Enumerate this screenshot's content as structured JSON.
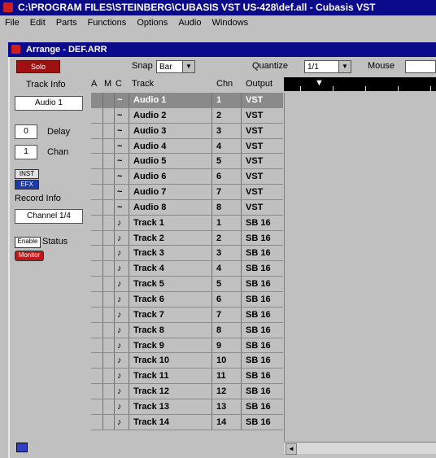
{
  "app_title": "C:\\PROGRAM FILES\\STEINBERG\\CUBASIS VST US-428\\def.all - Cubasis VST",
  "menu": [
    "File",
    "Edit",
    "Parts",
    "Functions",
    "Options",
    "Audio",
    "Windows"
  ],
  "arrange": {
    "title": "Arrange - DEF.ARR",
    "solo_label": "Solo",
    "snap_label": "Snap",
    "snap_value": "Bar",
    "quantize_label": "Quantize",
    "quantize_value": "1/1",
    "mouse_label": "Mouse"
  },
  "inspector": {
    "track_info_label": "Track Info",
    "track_name": "Audio 1",
    "delay_value": "0",
    "delay_label": "Delay",
    "chan_value": "1",
    "chan_label": "Chan",
    "inst_btn": "INST",
    "efx_btn": "EFX",
    "record_info_label": "Record Info",
    "record_channel": "Channel 1/4",
    "enable_btn": "Enable",
    "status_label": "Status",
    "monitor_btn": "Monitor"
  },
  "columns": {
    "a": "A",
    "m": "M",
    "c": "C",
    "track": "Track",
    "chn": "Chn",
    "output": "Output"
  },
  "tracks": [
    {
      "type": "~",
      "name": "Audio 1",
      "chn": "1",
      "out": "VST"
    },
    {
      "type": "~",
      "name": "Audio 2",
      "chn": "2",
      "out": "VST"
    },
    {
      "type": "~",
      "name": "Audio 3",
      "chn": "3",
      "out": "VST"
    },
    {
      "type": "~",
      "name": "Audio 4",
      "chn": "4",
      "out": "VST"
    },
    {
      "type": "~",
      "name": "Audio 5",
      "chn": "5",
      "out": "VST"
    },
    {
      "type": "~",
      "name": "Audio 6",
      "chn": "6",
      "out": "VST"
    },
    {
      "type": "~",
      "name": "Audio 7",
      "chn": "7",
      "out": "VST"
    },
    {
      "type": "~",
      "name": "Audio 8",
      "chn": "8",
      "out": "VST"
    },
    {
      "type": "♪",
      "name": "Track 1",
      "chn": "1",
      "out": "SB 16"
    },
    {
      "type": "♪",
      "name": "Track 2",
      "chn": "2",
      "out": "SB 16"
    },
    {
      "type": "♪",
      "name": "Track 3",
      "chn": "3",
      "out": "SB 16"
    },
    {
      "type": "♪",
      "name": "Track 4",
      "chn": "4",
      "out": "SB 16"
    },
    {
      "type": "♪",
      "name": "Track 5",
      "chn": "5",
      "out": "SB 16"
    },
    {
      "type": "♪",
      "name": "Track 6",
      "chn": "6",
      "out": "SB 16"
    },
    {
      "type": "♪",
      "name": "Track 7",
      "chn": "7",
      "out": "SB 16"
    },
    {
      "type": "♪",
      "name": "Track 8",
      "chn": "8",
      "out": "SB 16"
    },
    {
      "type": "♪",
      "name": "Track 9",
      "chn": "9",
      "out": "SB 16"
    },
    {
      "type": "♪",
      "name": "Track 10",
      "chn": "10",
      "out": "SB 16"
    },
    {
      "type": "♪",
      "name": "Track 11",
      "chn": "11",
      "out": "SB 16"
    },
    {
      "type": "♪",
      "name": "Track 12",
      "chn": "12",
      "out": "SB 16"
    },
    {
      "type": "♪",
      "name": "Track 13",
      "chn": "13",
      "out": "SB 16"
    },
    {
      "type": "♪",
      "name": "Track 14",
      "chn": "14",
      "out": "SB 16"
    }
  ],
  "ruler_marker": "▼",
  "scroll_left": "◄"
}
